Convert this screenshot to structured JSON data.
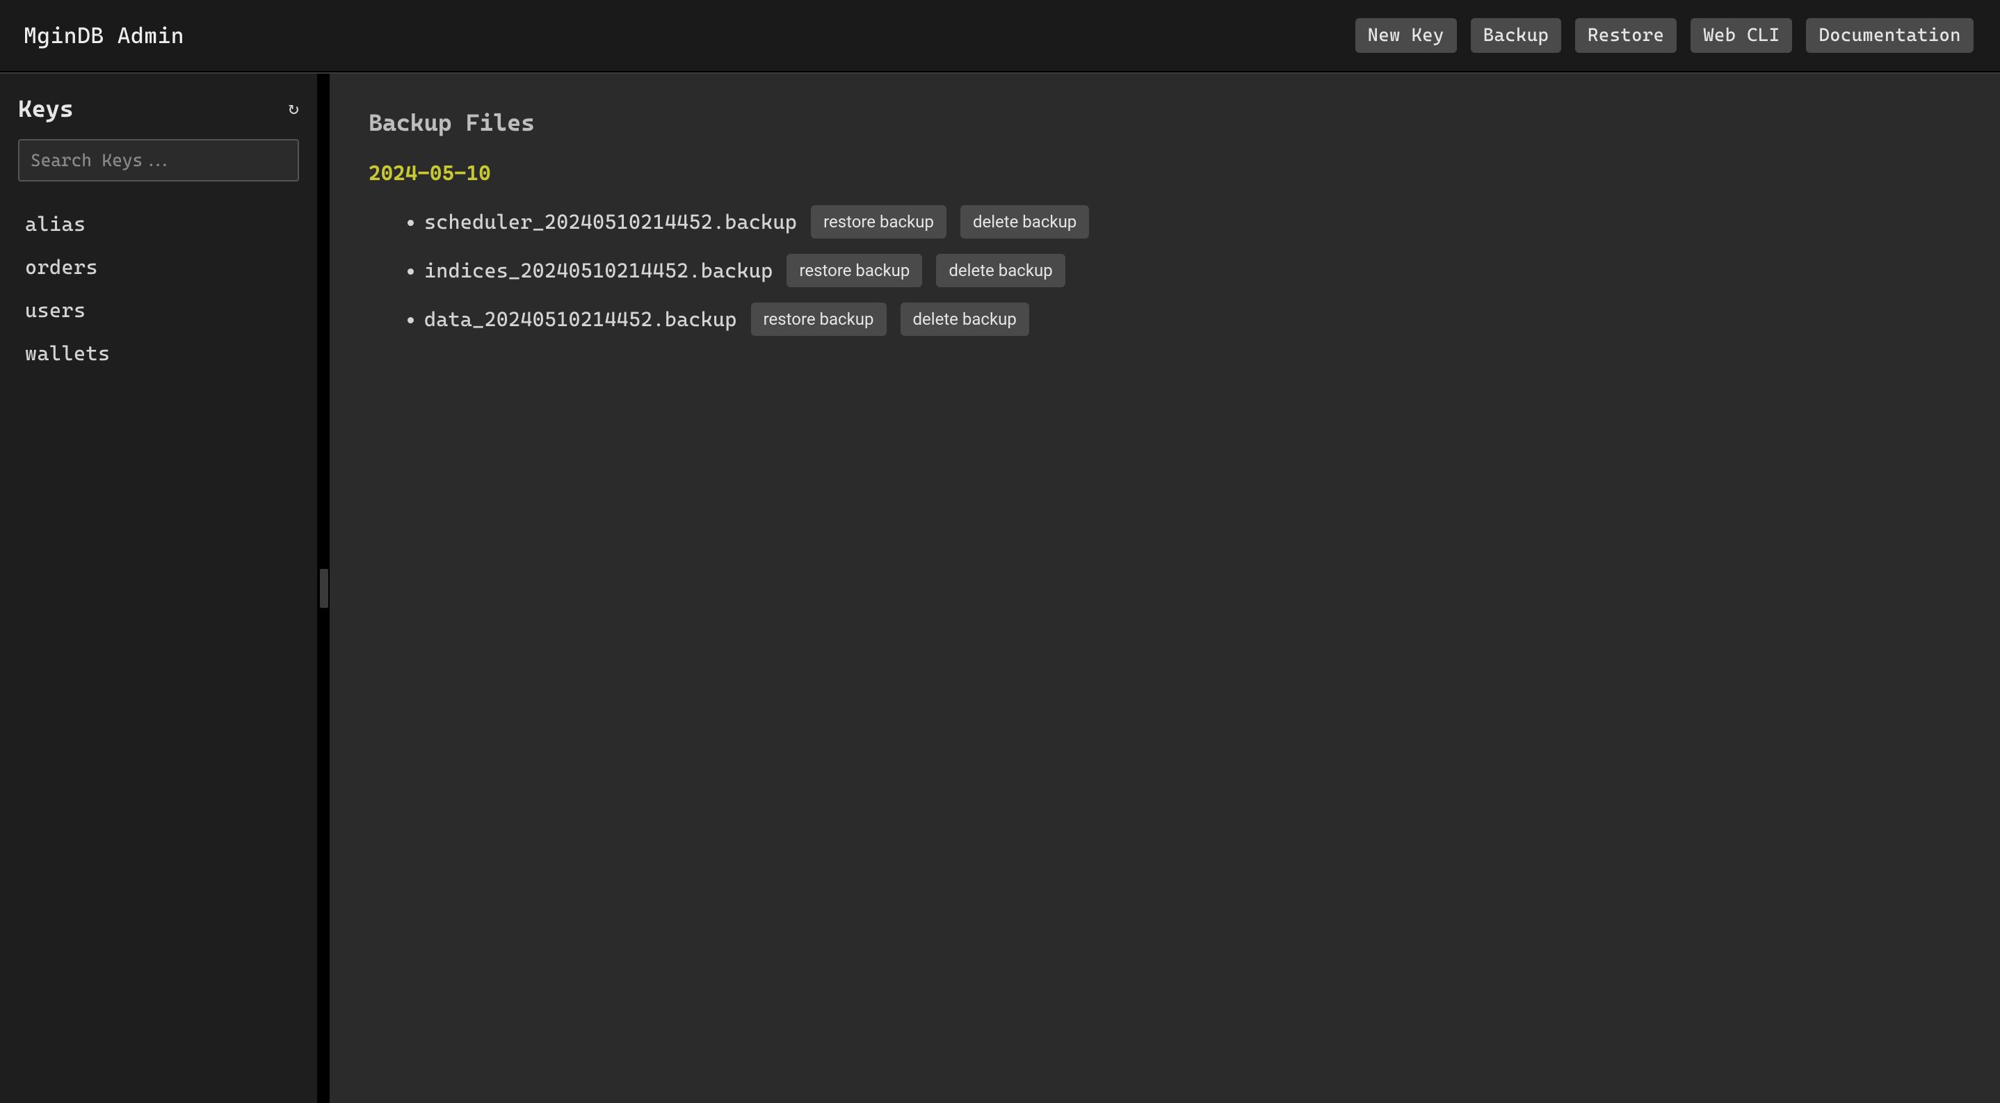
{
  "header": {
    "title": "MginDB Admin",
    "buttons": {
      "new_key": "New Key",
      "backup": "Backup",
      "restore": "Restore",
      "web_cli": "Web CLI",
      "documentation": "Documentation"
    }
  },
  "sidebar": {
    "title": "Keys",
    "refresh_glyph": "↻",
    "search_placeholder": "Search Keys...",
    "keys": [
      "alias",
      "orders",
      "users",
      "wallets"
    ]
  },
  "main": {
    "title": "Backup Files",
    "date": "2024-05-10",
    "restore_label": "restore backup",
    "delete_label": "delete backup",
    "files": [
      "scheduler_20240510214452.backup",
      "indices_20240510214452.backup",
      "data_20240510214452.backup"
    ]
  }
}
